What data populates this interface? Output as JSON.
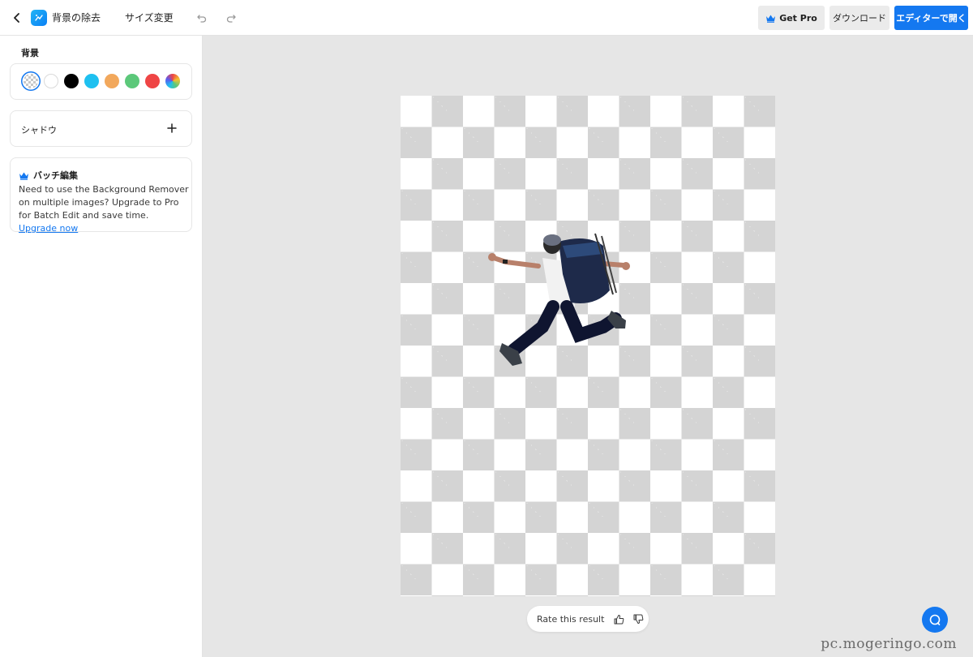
{
  "header": {
    "title": "背景の除去",
    "resize_label": "サイズ変更",
    "get_pro_label": "Get Pro",
    "download_label": "ダウンロード",
    "open_editor_label": "エディターで開く"
  },
  "sidebar": {
    "background_label": "背景",
    "swatches": [
      {
        "name": "transparent",
        "color": "transparent",
        "selected": true
      },
      {
        "name": "white",
        "color": "#ffffff"
      },
      {
        "name": "black",
        "color": "#000000"
      },
      {
        "name": "cyan",
        "color": "#1ec0f0"
      },
      {
        "name": "orange",
        "color": "#f2a85c"
      },
      {
        "name": "green",
        "color": "#5cc87a"
      },
      {
        "name": "red",
        "color": "#ef4545"
      },
      {
        "name": "custom-gradient",
        "color": "conic"
      }
    ],
    "shadow_label": "シャドウ",
    "batch": {
      "title": "バッチ編集",
      "text": "Need to use the Background Remover on multiple images? Upgrade to Pro for Batch Edit and save time.",
      "link": "Upgrade now"
    }
  },
  "canvas": {
    "rate_label": "Rate this result"
  },
  "watermark": "pc.mogeringo.com",
  "colors": {
    "accent": "#1478f0",
    "pro_crown": "#1478f0"
  }
}
